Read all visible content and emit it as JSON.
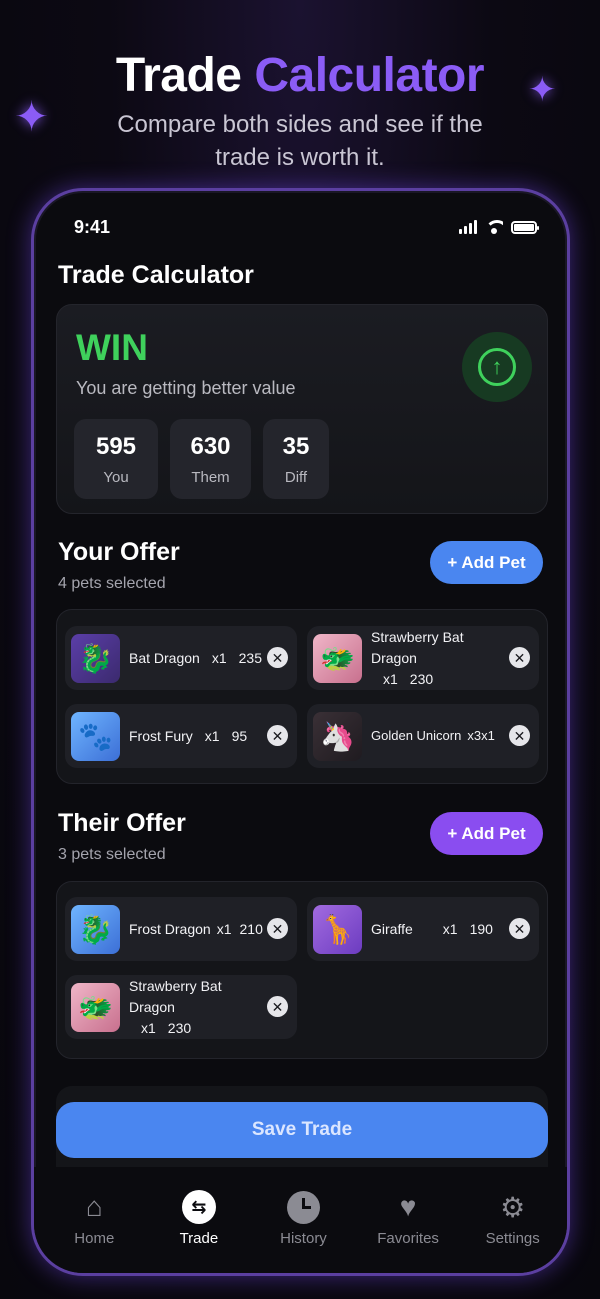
{
  "hero": {
    "title_main": "Trade",
    "title_accent": "Calculator",
    "subtitle": "Compare both sides and see if the trade is worth it.",
    "accent_color": "#8b5cf6"
  },
  "status_bar": {
    "time": "9:41"
  },
  "screen": {
    "title": "Trade Calculator"
  },
  "result": {
    "verdict": "WIN",
    "message": "You are getting better value",
    "verdict_color": "#3fd15c",
    "stats": [
      {
        "value": "595",
        "label": "You"
      },
      {
        "value": "630",
        "label": "Them"
      },
      {
        "value": "35",
        "label": "Diff"
      }
    ]
  },
  "your_offer": {
    "title": "Your Offer",
    "count_text": "4 pets selected",
    "add_label": "+ Add Pet",
    "pets": [
      {
        "name": "Bat Dragon",
        "qty": "x1",
        "value": "235",
        "icon": "bat-dragon"
      },
      {
        "name": "Strawberry Bat Dragon",
        "qty": "x1",
        "value": "230",
        "icon": "strawberry-bat-dragon"
      },
      {
        "name": "Frost Fury",
        "qty": "x1",
        "value": "95",
        "icon": "frost-fury"
      },
      {
        "name": "Golden Unicorn",
        "qty": "x1",
        "value": "x3",
        "icon": "golden-unicorn"
      }
    ]
  },
  "their_offer": {
    "title": "Their Offer",
    "count_text": "3 pets selected",
    "add_label": "+ Add Pet",
    "pets": [
      {
        "name": "Frost Dragon",
        "qty": "x1",
        "value": "210",
        "icon": "frost-dragon"
      },
      {
        "name": "Giraffe",
        "qty": "x1",
        "value": "190",
        "icon": "giraffe"
      },
      {
        "name": "Strawberry Bat Dragon",
        "qty": "x1",
        "value": "230",
        "icon": "strawberry-bat-dragon"
      }
    ]
  },
  "save": {
    "label": "Save Trade",
    "color": "#4a86f0"
  },
  "tabs": [
    {
      "label": "Home",
      "icon": "home-icon"
    },
    {
      "label": "Trade",
      "icon": "trade-icon"
    },
    {
      "label": "History",
      "icon": "clock-icon"
    },
    {
      "label": "Favorites",
      "icon": "heart-icon"
    },
    {
      "label": "Settings",
      "icon": "gear-icon"
    }
  ]
}
